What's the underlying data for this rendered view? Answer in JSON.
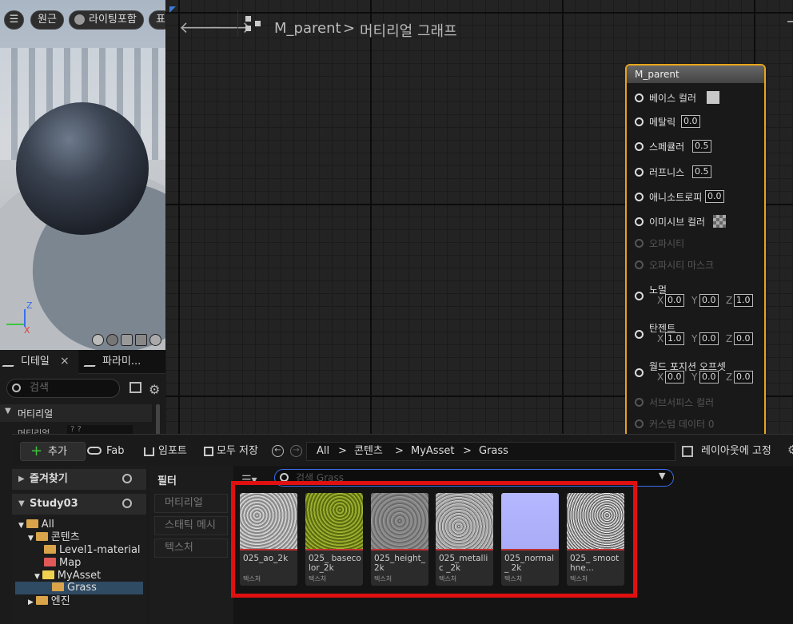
{
  "viewport": {
    "buttons": {
      "menu": "☰",
      "perspective": "원근",
      "lighting": "라이팅포함",
      "show": "표"
    },
    "axis": {
      "z": "Z",
      "x": "X"
    }
  },
  "details": {
    "tabs": [
      {
        "label": "디테일",
        "close": "×"
      },
      {
        "label": "파라미..."
      }
    ],
    "search_placeholder": "검색",
    "section": "머티리얼",
    "row_label": "머티리얼",
    "row_value": "? ?"
  },
  "graph": {
    "breadcrumb": {
      "asset": "M_parent",
      "sep": ">",
      "page": "머티리얼 그래프"
    },
    "node": {
      "title": "M_parent",
      "pins": [
        {
          "label": "베이스 컬러",
          "kind": "swatch",
          "color": "#c8c8c8"
        },
        {
          "label": "메탈릭",
          "kind": "value",
          "value": "0.0"
        },
        {
          "label": "스페큘러",
          "kind": "value",
          "value": "0.5"
        },
        {
          "label": "러프니스",
          "kind": "value",
          "value": "0.5"
        },
        {
          "label": "애니소트로피",
          "kind": "value",
          "value": "0.0"
        },
        {
          "label": "이미시브 컬러",
          "kind": "checker"
        },
        {
          "label": "오파시티",
          "kind": "disabled"
        },
        {
          "label": "오파시티 마스크",
          "kind": "disabled"
        },
        {
          "label": "노멀",
          "kind": "vector",
          "x": "0.0",
          "y": "0.0",
          "z": "1.0"
        },
        {
          "label": "탄젠트",
          "kind": "vector",
          "x": "1.0",
          "y": "0.0",
          "z": "0.0"
        },
        {
          "label": "월드 포지션 오프셋",
          "kind": "vector",
          "x": "0.0",
          "y": "0.0",
          "z": "0.0"
        },
        {
          "label": "서브서피스 컬러",
          "kind": "disabled"
        },
        {
          "label": "커스텀 데이터 0",
          "kind": "disabled"
        }
      ],
      "axis_labels": {
        "x": "X",
        "y": "Y",
        "z": "Z"
      }
    }
  },
  "content_browser": {
    "toolbar": {
      "add": "추가",
      "fab": "Fab",
      "import": "임포트",
      "save_all": "모두 저장",
      "path": [
        "All",
        "콘텐츠",
        "MyAsset",
        "Grass"
      ],
      "path_sep": ">",
      "lock_layout": "레이아웃에 고정"
    },
    "favorites": "즐겨찾기",
    "project": "Study03",
    "tree": [
      {
        "label": "All"
      },
      {
        "label": "콘텐츠"
      },
      {
        "label": "Level1-material"
      },
      {
        "label": "Map"
      },
      {
        "label": "MyAsset"
      },
      {
        "label": "Grass"
      },
      {
        "label": "엔진"
      }
    ],
    "filter_title": "필터",
    "filters": [
      "머티리얼",
      "스태틱 메시",
      "텍스처"
    ],
    "search_placeholder": "검색 Grass",
    "assets": [
      {
        "name": "025_ao_2k",
        "type": "텍스처"
      },
      {
        "name": "025_ basecolor_2k",
        "type": "텍스처"
      },
      {
        "name": "025_height_ 2k",
        "type": "텍스처"
      },
      {
        "name": "025_metallic _2k",
        "type": "텍스처"
      },
      {
        "name": "025_normal_ 2k",
        "type": "텍스처"
      },
      {
        "name": "025_ smoothne...",
        "type": "텍스처"
      }
    ]
  },
  "colors": {
    "node_border": "#e8a41b",
    "highlight": "#e01010",
    "folder": "#d9a44a",
    "selected": "#2f4a63"
  }
}
